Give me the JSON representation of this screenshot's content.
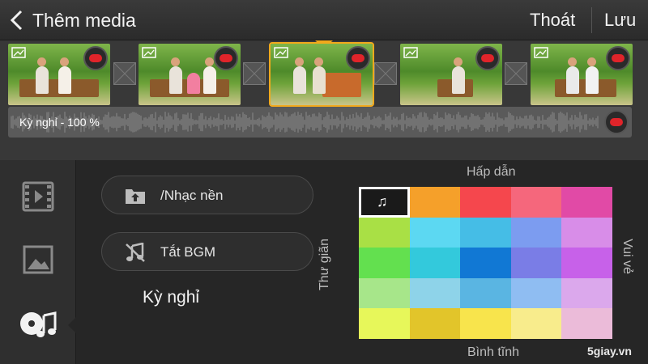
{
  "header": {
    "title": "Thêm media",
    "exit_label": "Thoát",
    "save_label": "Lưu"
  },
  "timeline": {
    "clips": [
      {
        "name": "clip-1",
        "selected": false
      },
      {
        "name": "clip-2",
        "selected": false
      },
      {
        "name": "clip-3",
        "selected": true
      },
      {
        "name": "clip-4",
        "selected": false
      },
      {
        "name": "clip-5",
        "selected": false
      }
    ],
    "audio_label": "Kỳ nghỉ - 100 %"
  },
  "sidebar": {
    "tabs": [
      "video-icon",
      "image-icon",
      "music-icon"
    ],
    "active_tab": 2
  },
  "music": {
    "folder_label": "/Nhạc nền",
    "mute_label": "Tắt BGM",
    "theme_name": "Kỳ nghỉ",
    "axis": {
      "top": "Hấp dẫn",
      "bottom": "Bình tĩnh",
      "left": "Thư giãn",
      "right": "Vui vẻ"
    },
    "grid_colors": [
      [
        "#1a1a1a",
        "#f5a02a",
        "#f5474d",
        "#f5677c",
        "#e14aa6"
      ],
      [
        "#a9e045",
        "#5cd8f2",
        "#45bde6",
        "#7c9cf0",
        "#d88de8"
      ],
      [
        "#63e04f",
        "#33c9dc",
        "#1178d4",
        "#7a7de6",
        "#c761e9"
      ],
      [
        "#a7e68a",
        "#8ed3e9",
        "#5ab5e2",
        "#8fbdf2",
        "#dba8ec"
      ],
      [
        "#e7f75a",
        "#e2c52a",
        "#f8e44c",
        "#f8ec8c",
        "#ebbbd9"
      ]
    ],
    "selected_cell": [
      0,
      0
    ]
  },
  "watermark": "5giay.vn"
}
